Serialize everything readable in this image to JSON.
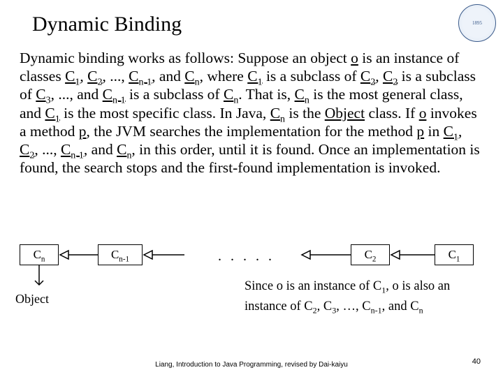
{
  "title": "Dynamic Binding",
  "logo_text": "1895",
  "body": {
    "t0": "Dynamic binding works as follows: Suppose an object ",
    "o": "o",
    "t1": " is an instance of classes ",
    "c1": "C",
    "s1": "1",
    "comma1": ", ",
    "c2": "C",
    "s2": "2",
    "comma2": ", ..., ",
    "cn1a": "C",
    "sn1a": "n-1",
    "comma3": ", and ",
    "cna": "C",
    "sna": "n",
    "t2": ", where ",
    "c1b": "C",
    "s1b": "1",
    "t3": " is a subclass of ",
    "c2b": "C",
    "s2b": "2",
    "comma4": ", ",
    "c2c": "C",
    "s2c": "2",
    "t4": " is a subclass of ",
    "c3": "C",
    "s3": "3",
    "comma5": ", ..., and ",
    "cn1b": "C",
    "sn1b": "n-1",
    "t5": " is a subclass of ",
    "cnb": "C",
    "snb": "n",
    "t6": ". That is, ",
    "cnc": "C",
    "snc": "n",
    "t7": " is the most general class, and ",
    "c1c": "C",
    "s1c": "1",
    "t8": " is the most specific class. In Java, ",
    "cnd": "C",
    "snd": "n",
    "t9": " is the ",
    "obj": "Object",
    "t10": " class. If ",
    "o2": "o",
    "t11": " invokes a method ",
    "p": "p",
    "t12": ", the JVM searches the implementation for the method ",
    "p2": "p",
    "t13": " in ",
    "c1d": "C",
    "s1d": "1",
    "comma6": ", ",
    "c2d": "C",
    "s2d": "2",
    "comma7": ", ..., ",
    "cn1c": "C",
    "sn1c": "n-1",
    "comma8": ", and ",
    "cne": "C",
    "sne": "n",
    "t14": ", in this order, until it is found. Once an implementation is found, the search stops and the first-found implementation is invoked."
  },
  "diagram": {
    "b_cn": "C",
    "b_cn_s": "n",
    "b_cn1": "C",
    "b_cn1_s": "n-1",
    "b_c2": "C",
    "b_c2_s": "2",
    "b_c1": "C",
    "b_c1_s": "1",
    "dots": ". . . . .",
    "object_label": "Object",
    "caption_l1": "Since o is an instance of C",
    "cap_s1": "1",
    "caption_l1b": ", o is also an",
    "caption_l2": "instance of C",
    "cap_s2": "2",
    "cap_c3": ", C",
    "cap_s3": "3",
    "cap_dots": ", …, C",
    "cap_sn1": "n-1",
    "cap_and": ", and C",
    "cap_sn": "n"
  },
  "footer": "Liang, Introduction to Java Programming, revised by Dai-kaiyu",
  "page_number": "40"
}
